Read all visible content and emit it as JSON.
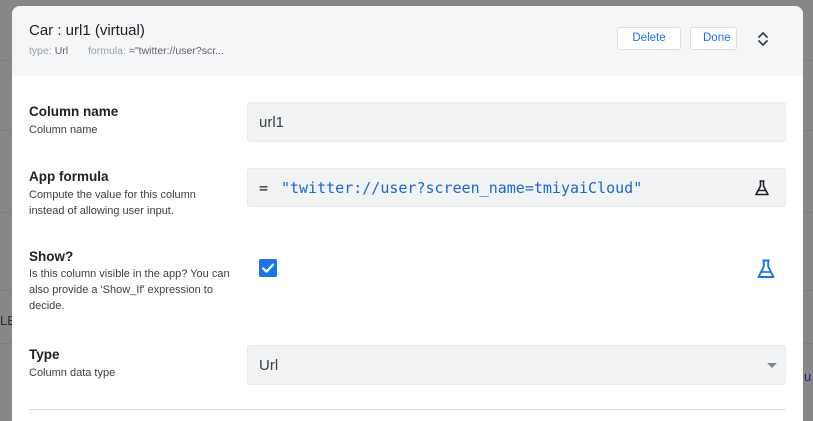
{
  "background": {
    "left_fragment": "LE",
    "right_fragment": "u"
  },
  "header": {
    "title": "Car : url1 (virtual)",
    "type_label": "type:",
    "type_value": "Url",
    "formula_label": "formula:",
    "formula_value": "=\"twitter://user?scr...",
    "delete_label": "Delete",
    "done_label": "Done",
    "expand_icon": "unfold-more-icon"
  },
  "fields": {
    "column_name": {
      "label": "Column name",
      "description": "Column name",
      "value": "url1"
    },
    "app_formula": {
      "label": "App formula",
      "description": "Compute the value for this column instead of allowing user input.",
      "equals": "=",
      "expression": "\"twitter://user?screen_name=tmiyaiCloud\"",
      "icon": "flask-icon"
    },
    "show": {
      "label": "Show?",
      "description": "Is this column visible in the app? You can also provide a 'Show_If' expression to decide.",
      "checked": true,
      "icon": "flask-icon"
    },
    "type": {
      "label": "Type",
      "description": "Column data type",
      "value": "Url"
    }
  },
  "colors": {
    "accent": "#1a73e8",
    "formula_text": "#1a66d6",
    "header_bg": "#f5f6f7",
    "field_bg": "#f1f3f4"
  }
}
